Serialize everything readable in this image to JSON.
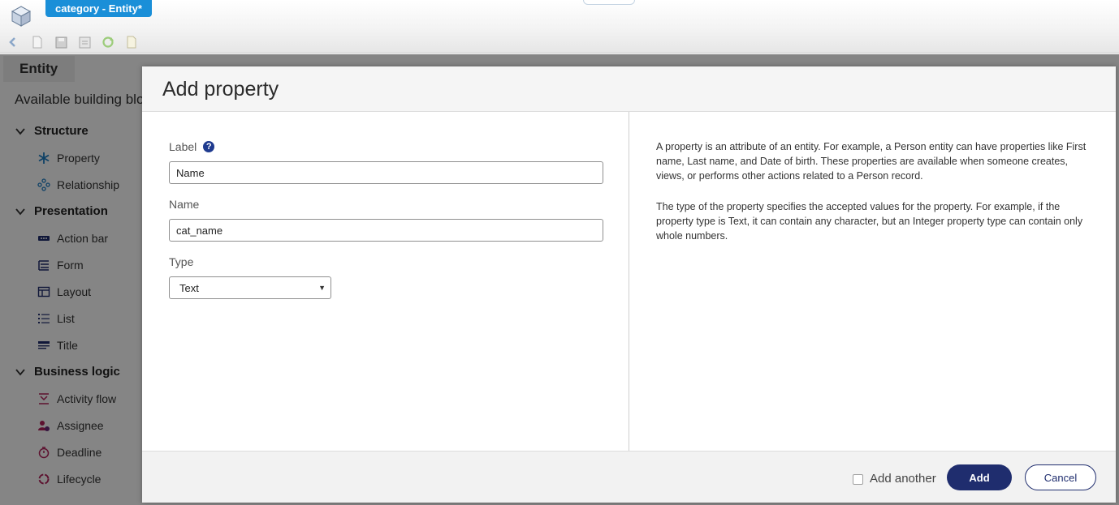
{
  "app": {
    "document_tab": "category - Entity*"
  },
  "toolbar": {
    "buttons": [
      "back-icon",
      "new-icon",
      "save-icon",
      "save-as-icon",
      "refresh-icon",
      "edit-icon"
    ]
  },
  "left_panel": {
    "tab": "Entity",
    "available_heading": "Available building blocks",
    "groups": [
      {
        "label": "Structure",
        "items": [
          {
            "label": "Property",
            "icon": "asterisk-icon"
          },
          {
            "label": "Relationship",
            "icon": "relationship-icon"
          }
        ]
      },
      {
        "label": "Presentation",
        "items": [
          {
            "label": "Action bar",
            "icon": "action-bar-icon"
          },
          {
            "label": "Form",
            "icon": "form-icon"
          },
          {
            "label": "Layout",
            "icon": "layout-icon"
          },
          {
            "label": "List",
            "icon": "list-icon"
          },
          {
            "label": "Title",
            "icon": "title-icon"
          }
        ]
      },
      {
        "label": "Business logic",
        "items": [
          {
            "label": "Activity flow",
            "icon": "activity-flow-icon"
          },
          {
            "label": "Assignee",
            "icon": "assignee-icon"
          },
          {
            "label": "Deadline",
            "icon": "deadline-icon"
          },
          {
            "label": "Lifecycle",
            "icon": "lifecycle-icon"
          }
        ]
      }
    ]
  },
  "dialog": {
    "title": "Add property",
    "label_field": {
      "label": "Label",
      "value": "Name"
    },
    "name_field": {
      "label": "Name",
      "value": "cat_name"
    },
    "type_field": {
      "label": "Type",
      "value": "Text"
    },
    "description_1": "A property is an attribute of an entity. For example, a Person entity can have properties like First name, Last name, and Date of birth. These properties are available when someone creates, views, or performs other actions related to a Person record.",
    "description_2": "The type of the property specifies the accepted values for the property. For example, if the property type is Text, it can contain any character, but an Integer property type can contain only whole numbers.",
    "add_another_label": "Add another",
    "add_another_checked": false,
    "add_button": "Add",
    "cancel_button": "Cancel"
  },
  "colors": {
    "tab_blue": "#1a8fd8",
    "primary_navy": "#1f2d6e",
    "help_icon": "#1f3b8f"
  }
}
